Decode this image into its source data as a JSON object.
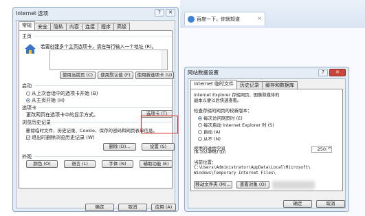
{
  "browser": {
    "tab_title": "百度一下，你就知道",
    "close_glyph": "×"
  },
  "main_dialog": {
    "title": "Internet 选项",
    "help_glyph": "?",
    "close_glyph": "✕",
    "tabs": [
      "常规",
      "安全",
      "隐私",
      "内容",
      "连接",
      "程序",
      "高级"
    ],
    "home": {
      "header": "主页",
      "desc": "若要创建多个主页选项卡，请在每行输入一个地址 (R)。",
      "buttons": [
        "使用当前页 (C)",
        "使用默认值 (F)",
        "使用新选项卡 (U)"
      ]
    },
    "startup": {
      "header": "启动",
      "options": [
        "从上次会话中的选项卡开始 (B)",
        "从主页开始 (H)"
      ]
    },
    "tabs_section": {
      "header": "选项卡",
      "desc": "更改网页在选项卡中的显示方式。",
      "button": "选项卡 (T)"
    },
    "history": {
      "header": "浏览历史记录",
      "desc": "删除临时文件、历史记录、Cookie、保存的密码和网页表单信息。",
      "checkbox": "退出时删除浏览历史记录 (W)",
      "delete_button": "删除 (D)...",
      "settings_button": "设置 (S)"
    },
    "appearance": {
      "header": "外观",
      "buttons": [
        "颜色 (O)",
        "语言 (L)",
        "字体 (N)",
        "辅助功能 (E)"
      ]
    },
    "footer_buttons": [
      "确定",
      "取消",
      "应用 (A)"
    ]
  },
  "settings_dialog": {
    "title": "网站数据设置",
    "close_glyph": "✕",
    "help_glyph": "?",
    "tabs": [
      "Internet 临时文件",
      "历史记录",
      "缓存和数据库"
    ],
    "intro": "Internet Explorer 存储网页、图像和媒体的副本以便以后快速查看。",
    "check_label": "检查存储的网页的较新版本：",
    "options": [
      "每次访问网页时 (E)",
      "每次启动 Internet Explorer 时 (S)",
      "自动 (A)",
      "从不 (N)"
    ],
    "disk_label_1": "使用的磁盘空间",
    "disk_label_2": "(8-1024MB) (D)",
    "disk_value": "250",
    "spin_glyph": "▴▾",
    "location_label": "当前位置：",
    "location_path_1": "C:\\Users\\Administrator\\AppData\\Local\\Microsoft\\",
    "location_path_2": "Windows\\Temporary Internet Files\\",
    "buttons": [
      "移动文件夹 (M)...",
      "查看对象 (O)"
    ],
    "footer_buttons": [
      "确定",
      "取消"
    ]
  }
}
